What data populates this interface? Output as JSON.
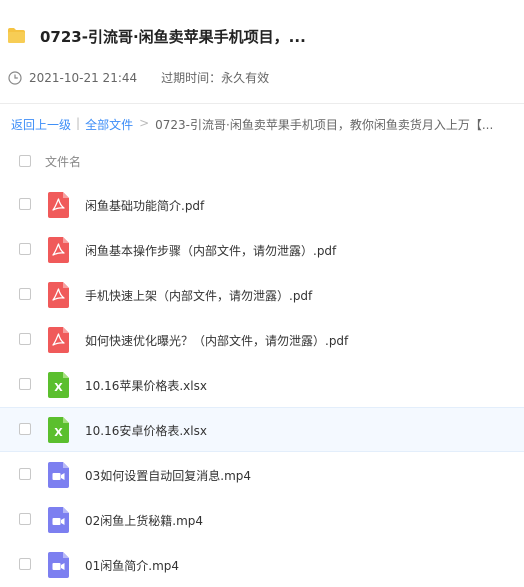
{
  "header": {
    "title": "0723-引流哥·闲鱼卖苹果手机项目，...",
    "date": "2021-10-21 21:44",
    "expire_label": "过期时间：",
    "expire_value": "永久有效"
  },
  "breadcrumb": {
    "back": "返回上一级",
    "separator": "|",
    "all_files": "全部文件",
    "gt": ">",
    "current": "0723-引流哥·闲鱼卖苹果手机项目，教你闲鱼卖货月入上万【..."
  },
  "list": {
    "column_name": "文件名",
    "rows": [
      {
        "name": "闲鱼基础功能简介.pdf",
        "type": "pdf"
      },
      {
        "name": "闲鱼基本操作步骤（内部文件，请勿泄露）.pdf",
        "type": "pdf"
      },
      {
        "name": "手机快速上架（内部文件，请勿泄露）.pdf",
        "type": "pdf"
      },
      {
        "name": "如何快速优化曝光？（内部文件，请勿泄露）.pdf",
        "type": "pdf"
      },
      {
        "name": "10.16苹果价格表.xlsx",
        "type": "xlsx"
      },
      {
        "name": "10.16安卓价格表.xlsx",
        "type": "xlsx",
        "hover": true
      },
      {
        "name": "03如何设置自动回复消息.mp4",
        "type": "mp4"
      },
      {
        "name": "02闲鱼上货秘籍.mp4",
        "type": "mp4"
      },
      {
        "name": "01闲鱼简介.mp4",
        "type": "mp4"
      }
    ]
  },
  "icons": {
    "folder": "folder-icon",
    "clock": "clock-icon",
    "pdf": "pdf-file-icon",
    "xlsx": "excel-file-icon",
    "mp4": "video-file-icon"
  },
  "colors": {
    "folder": "#f5c342",
    "pdf": "#f05a5a",
    "xlsx": "#5bbf2e",
    "mp4": "#7c7ff0",
    "link": "#3e8ef7"
  }
}
